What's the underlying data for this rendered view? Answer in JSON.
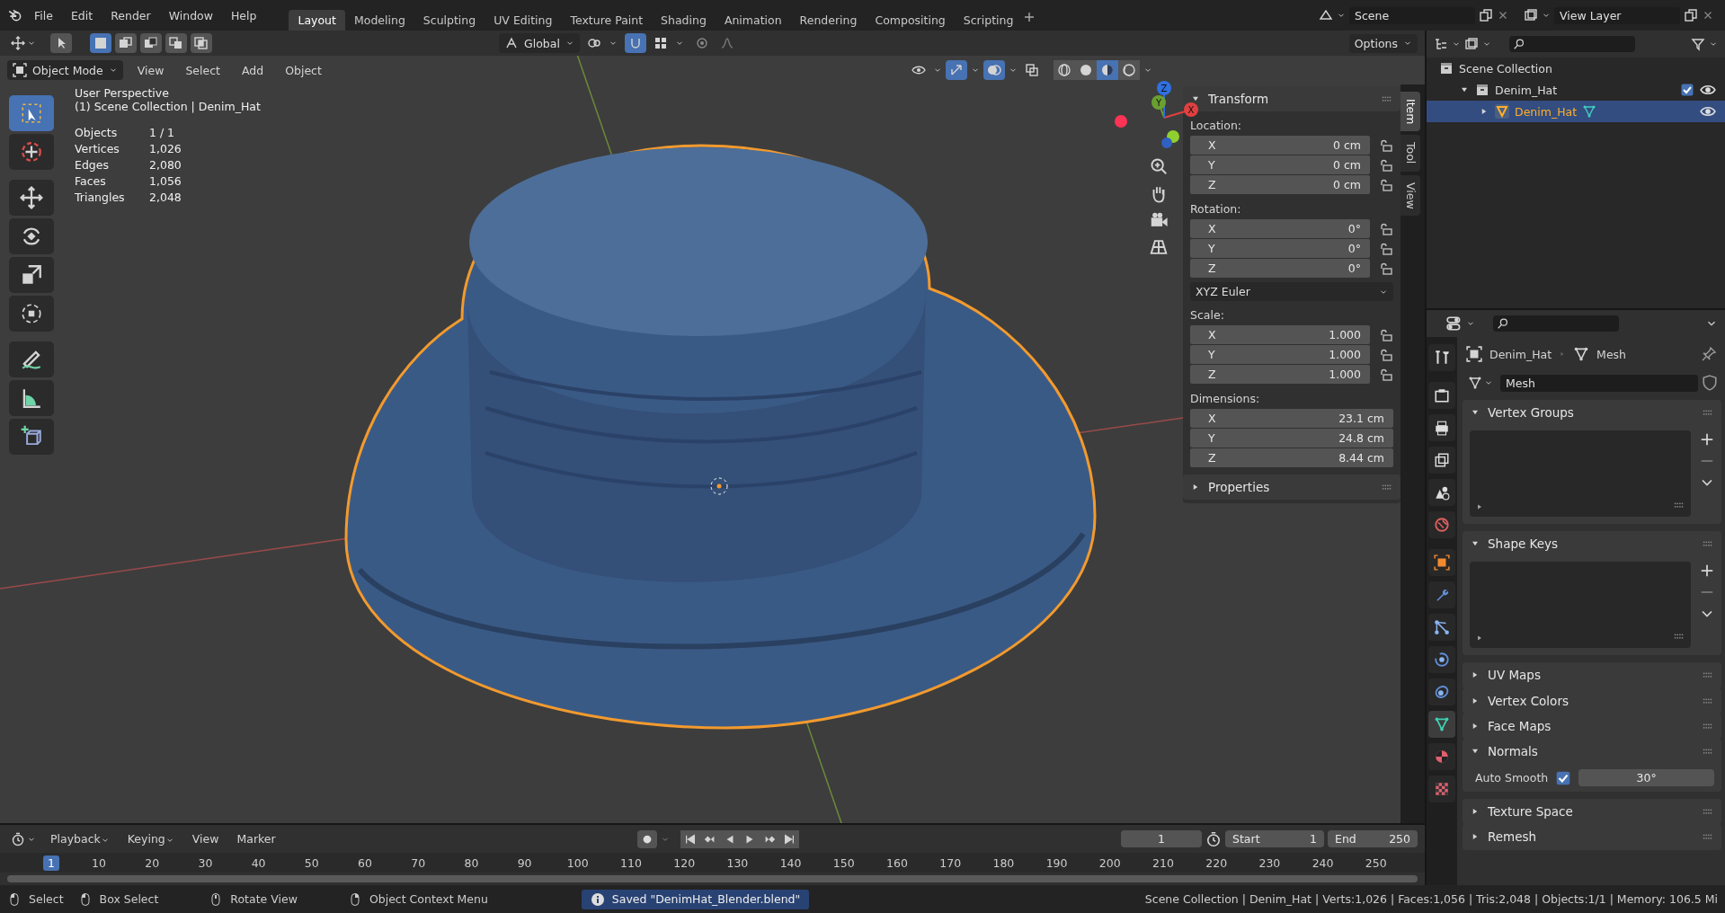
{
  "menu": [
    "File",
    "Edit",
    "Render",
    "Window",
    "Help"
  ],
  "workspaces": [
    {
      "label": "Layout",
      "selected": true
    },
    {
      "label": "Modeling",
      "selected": false
    },
    {
      "label": "Sculpting",
      "selected": false
    },
    {
      "label": "UV Editing",
      "selected": false
    },
    {
      "label": "Texture Paint",
      "selected": false
    },
    {
      "label": "Shading",
      "selected": false
    },
    {
      "label": "Animation",
      "selected": false
    },
    {
      "label": "Rendering",
      "selected": false
    },
    {
      "label": "Compositing",
      "selected": false
    },
    {
      "label": "Scripting",
      "selected": false
    }
  ],
  "scene": "Scene",
  "view_layer": "View Layer",
  "tool_header": {
    "select_modes": [
      {
        "kind": "set",
        "selected": true
      },
      {
        "kind": "extend",
        "selected": false
      },
      {
        "kind": "subtract",
        "selected": false
      },
      {
        "kind": "invert",
        "selected": false
      },
      {
        "kind": "intersect",
        "selected": false
      }
    ],
    "orientation": "Global",
    "snap": true,
    "proportional": false,
    "options": "Options"
  },
  "viewport_header": {
    "mode": "Object Mode",
    "menus": [
      "View",
      "Select",
      "Add",
      "Object"
    ],
    "toggles": [
      {
        "kind": "visibility",
        "on": false
      },
      {
        "kind": "gizmo",
        "on": true
      },
      {
        "kind": "overlay",
        "on": true
      },
      {
        "kind": "xray",
        "on": false
      }
    ],
    "shading": [
      {
        "kind": "wireframe",
        "selected": false
      },
      {
        "kind": "solid",
        "selected": false
      },
      {
        "kind": "material",
        "selected": true
      },
      {
        "kind": "rendered",
        "selected": false
      }
    ]
  },
  "toolbar": [
    {
      "kind": "select",
      "selected": true
    },
    {
      "kind": "cursor",
      "selected": false
    },
    {
      "kind": "move",
      "selected": false
    },
    {
      "kind": "rotate",
      "selected": false
    },
    {
      "kind": "scale",
      "selected": false
    },
    {
      "kind": "transform",
      "selected": false
    },
    {
      "kind": "annotate",
      "selected": false
    },
    {
      "kind": "measure",
      "selected": false
    },
    {
      "kind": "add_cube",
      "selected": false
    }
  ],
  "overlay": {
    "view": "User Perspective",
    "collection": "(1) Scene Collection | Denim_Hat",
    "stats": [
      {
        "label": "Objects",
        "value": "1 / 1"
      },
      {
        "label": "Vertices",
        "value": "1,026"
      },
      {
        "label": "Edges",
        "value": "2,080"
      },
      {
        "label": "Faces",
        "value": "1,056"
      },
      {
        "label": "Triangles",
        "value": "2,048"
      }
    ]
  },
  "gizmo": {
    "axes": [
      "X",
      "Y",
      "Z"
    ]
  },
  "sidebar_tabs": [
    {
      "label": "Item",
      "selected": true
    },
    {
      "label": "Tool",
      "selected": false
    },
    {
      "label": "View",
      "selected": false
    }
  ],
  "transform": {
    "title": "Transform",
    "expanded": true,
    "groups": [
      {
        "label": "Location:",
        "fields": [
          {
            "axis": "X",
            "value": "0 cm",
            "locked": false
          },
          {
            "axis": "Y",
            "value": "0 cm",
            "locked": false
          },
          {
            "axis": "Z",
            "value": "0 cm",
            "locked": false
          }
        ]
      },
      {
        "label": "Rotation:",
        "fields": [
          {
            "axis": "X",
            "value": "0°",
            "locked": false
          },
          {
            "axis": "Y",
            "value": "0°",
            "locked": false
          },
          {
            "axis": "Z",
            "value": "0°",
            "locked": false
          }
        ],
        "mode": "XYZ Euler"
      },
      {
        "label": "Scale:",
        "fields": [
          {
            "axis": "X",
            "value": "1.000",
            "locked": false
          },
          {
            "axis": "Y",
            "value": "1.000",
            "locked": false
          },
          {
            "axis": "Z",
            "value": "1.000",
            "locked": false
          }
        ]
      },
      {
        "label": "Dimensions:",
        "fields": [
          {
            "axis": "X",
            "value": "23.1 cm"
          },
          {
            "axis": "Y",
            "value": "24.8 cm"
          },
          {
            "axis": "Z",
            "value": "8.44 cm"
          }
        ]
      }
    ]
  },
  "sidebar_panel": {
    "title": "Properties",
    "expanded": false
  },
  "outliner": {
    "items": [
      {
        "label": "Scene Collection",
        "kind": "scene",
        "children": [
          {
            "label": "Denim_Hat",
            "kind": "collection",
            "expanded": true,
            "checked": true,
            "visible": true,
            "children": [
              {
                "label": "Denim_Hat",
                "kind": "object",
                "expanded": false,
                "selected": true,
                "visible": true
              }
            ]
          }
        ]
      }
    ]
  },
  "properties": {
    "tabs": [
      {
        "kind": "tool",
        "selected": false
      },
      {
        "kind": "render",
        "selected": false
      },
      {
        "kind": "output",
        "selected": false
      },
      {
        "kind": "view_layer",
        "selected": false
      },
      {
        "kind": "scene",
        "selected": false
      },
      {
        "kind": "world",
        "selected": false
      },
      {
        "kind": "object",
        "selected": false
      },
      {
        "kind": "modifier",
        "selected": false
      },
      {
        "kind": "particles",
        "selected": false
      },
      {
        "kind": "physics",
        "selected": false
      },
      {
        "kind": "constraints",
        "selected": false
      },
      {
        "kind": "data",
        "selected": true
      },
      {
        "kind": "material",
        "selected": false
      },
      {
        "kind": "texture",
        "selected": false
      }
    ],
    "breadcrumb": [
      "Denim_Hat",
      "Mesh"
    ],
    "datablock": "Mesh",
    "panels": [
      {
        "title": "Vertex Groups",
        "expanded": true,
        "kind": "list"
      },
      {
        "title": "Shape Keys",
        "expanded": true,
        "kind": "list"
      },
      {
        "title": "UV Maps",
        "expanded": false
      },
      {
        "title": "Vertex Colors",
        "expanded": false
      },
      {
        "title": "Face Maps",
        "expanded": false
      },
      {
        "title": "Normals",
        "expanded": true,
        "kind": "normals",
        "label": "Auto Smooth",
        "checked": true,
        "value": "30°"
      },
      {
        "title": "Texture Space",
        "expanded": false
      },
      {
        "title": "Remesh",
        "expanded": false
      }
    ]
  },
  "timeline": {
    "menus": [
      {
        "label": "Playback",
        "dropdown": true
      },
      {
        "label": "Keying",
        "dropdown": true
      },
      {
        "label": "View",
        "dropdown": false
      },
      {
        "label": "Marker",
        "dropdown": false
      }
    ],
    "auto_keying": false,
    "current_frame": "1",
    "start_label": "Start",
    "start": "1",
    "end_label": "End",
    "end": "250",
    "ruler": [
      {
        "label": "1",
        "selected": true
      },
      {
        "label": "10",
        "selected": false
      },
      {
        "label": "20",
        "selected": false
      },
      {
        "label": "30",
        "selected": false
      },
      {
        "label": "40",
        "selected": false
      },
      {
        "label": "50",
        "selected": false
      },
      {
        "label": "60",
        "selected": false
      },
      {
        "label": "70",
        "selected": false
      },
      {
        "label": "80",
        "selected": false
      },
      {
        "label": "90",
        "selected": false
      },
      {
        "label": "100",
        "selected": false
      },
      {
        "label": "110",
        "selected": false
      },
      {
        "label": "120",
        "selected": false
      },
      {
        "label": "130",
        "selected": false
      },
      {
        "label": "140",
        "selected": false
      },
      {
        "label": "150",
        "selected": false
      },
      {
        "label": "160",
        "selected": false
      },
      {
        "label": "170",
        "selected": false
      },
      {
        "label": "180",
        "selected": false
      },
      {
        "label": "190",
        "selected": false
      },
      {
        "label": "200",
        "selected": false
      },
      {
        "label": "210",
        "selected": false
      },
      {
        "label": "220",
        "selected": false
      },
      {
        "label": "230",
        "selected": false
      },
      {
        "label": "240",
        "selected": false
      },
      {
        "label": "250",
        "selected": false
      }
    ]
  },
  "status_bar": {
    "hints": [
      {
        "kind": "left",
        "label": "Select"
      },
      {
        "kind": "left",
        "label": "Box Select"
      },
      {
        "kind": "middle",
        "label": "Rotate View"
      },
      {
        "kind": "right",
        "label": "Object Context Menu"
      }
    ],
    "message": "Saved \"DenimHat_Blender.blend\"",
    "stats": "Scene Collection | Denim_Hat | Verts:1,026 | Faces:1,056 | Tris:2,048 | Objects:1/1 | Memory: 106.5 Mi"
  }
}
